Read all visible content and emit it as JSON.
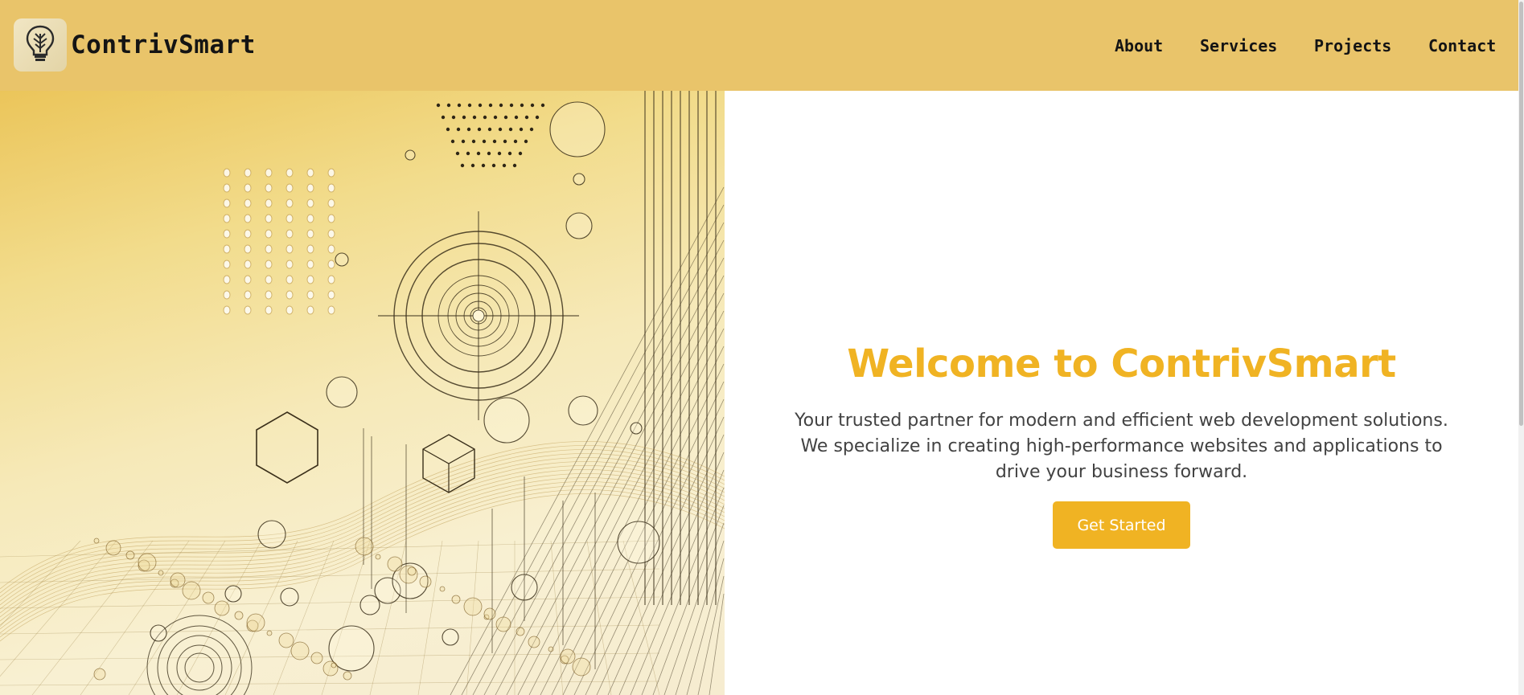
{
  "brand": {
    "name": "ContrivSmart",
    "logo_icon": "lightbulb-icon"
  },
  "nav": {
    "items": [
      "About",
      "Services",
      "Projects",
      "Contact"
    ]
  },
  "hero": {
    "title": "Welcome to ContrivSmart",
    "subtitle_lines": [
      "Your trusted partner for modern and efficient web development solutions.",
      "We specialize in creating high-performance websites and applications to",
      "drive your business forward."
    ],
    "cta_label": "Get Started"
  },
  "colors": {
    "header_bg": "#e9c46a",
    "accent": "#f0b323",
    "text_dark": "#141414",
    "text_body": "#424242"
  }
}
